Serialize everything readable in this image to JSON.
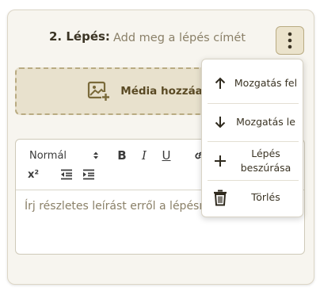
{
  "step": {
    "label": "2. Lépés:",
    "title_placeholder": "Add meg a lépés címét",
    "title_value": ""
  },
  "media": {
    "label": "Média hozzáadása"
  },
  "editor": {
    "format_select": "Normál",
    "toolbar_icons": [
      "bold-icon",
      "italic-icon",
      "underline-icon",
      "link-icon",
      "superscript-icon",
      "outdent-icon",
      "indent-icon"
    ],
    "bold_glyph": "B",
    "italic_glyph": "I",
    "underline_glyph": "U",
    "superscript_glyph": "x²",
    "body_placeholder": "Írj részletes leírást erről a lépésről..."
  },
  "menu": {
    "items": [
      {
        "label": "Mozgatás fel",
        "icon": "arrow-up-icon"
      },
      {
        "label": "Mozgatás le",
        "icon": "arrow-down-icon"
      },
      {
        "label": "Lépés beszúrása",
        "icon": "plus-icon"
      },
      {
        "label": "Törlés",
        "icon": "trash-icon"
      }
    ]
  },
  "colors": {
    "accent": "#7a6a3a",
    "accent_light": "#ebe3cc",
    "text": "#3b3424",
    "placeholder": "#8a8068"
  }
}
